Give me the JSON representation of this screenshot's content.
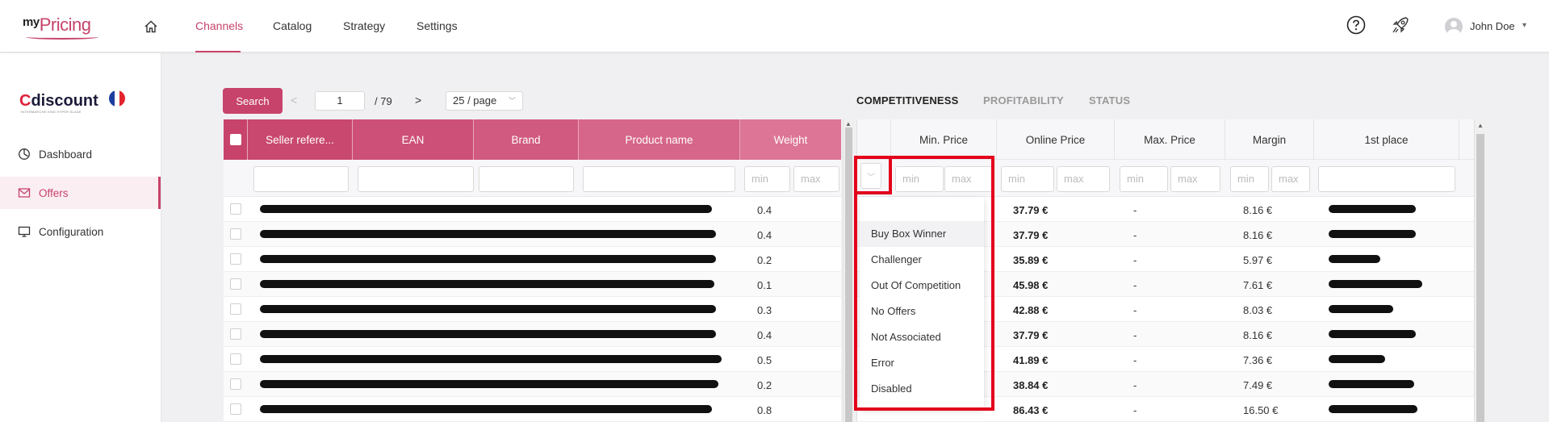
{
  "app": {
    "logo_my": "my",
    "logo_pricing": "Pricing"
  },
  "nav": {
    "items": [
      "Channels",
      "Catalog",
      "Strategy",
      "Settings"
    ],
    "active": "Channels"
  },
  "user": {
    "name": "John Doe"
  },
  "sidebar": {
    "channel_logo_c": "C",
    "channel_logo_rest": "discount",
    "channel_tagline": "INTERMARCHE EIND HYPER SLADE",
    "items": [
      {
        "label": "Dashboard",
        "icon": "dashboard-icon"
      },
      {
        "label": "Offers",
        "icon": "mail-icon",
        "active": true
      },
      {
        "label": "Configuration",
        "icon": "monitor-icon"
      }
    ]
  },
  "toolbar": {
    "search_label": "Search",
    "prev": "<",
    "page": "1",
    "total": "/  79",
    "next": ">",
    "page_size": "25 / page"
  },
  "tabs": [
    "COMPETITIVENESS",
    "PROFITABILITY",
    "STATUS"
  ],
  "left_table": {
    "columns": [
      "Seller refere...",
      "EAN",
      "Brand",
      "Product name",
      "Weight"
    ],
    "filter_min": "min",
    "filter_max": "max",
    "weights": [
      "0.4",
      "0.4",
      "0.2",
      "0.1",
      "0.3",
      "0.4",
      "0.5",
      "0.2",
      "0.8"
    ]
  },
  "right_table": {
    "columns": [
      "Min. Price",
      "Online Price",
      "Max. Price",
      "Margin",
      "1st place"
    ],
    "filter_min": "min",
    "filter_max": "max",
    "rows": [
      {
        "online": "37.79 €",
        "max": "-",
        "margin": "8.16 €"
      },
      {
        "online": "37.79 €",
        "max": "-",
        "margin": "8.16 €"
      },
      {
        "online": "35.89 €",
        "max": "-",
        "margin": "5.97 €"
      },
      {
        "online": "45.98 €",
        "max": "-",
        "margin": "7.61 €"
      },
      {
        "online": "42.88 €",
        "max": "-",
        "margin": "8.03 €"
      },
      {
        "online": "37.79 €",
        "max": "-",
        "margin": "8.16 €"
      },
      {
        "online": "41.89 €",
        "max": "-",
        "margin": "7.36 €"
      },
      {
        "online": "38.84 €",
        "max": "-",
        "margin": "7.49 €"
      },
      {
        "online": "86.43 €",
        "max": "-",
        "margin": "16.50 €"
      }
    ]
  },
  "status_dropdown": {
    "options": [
      "Buy Box Winner",
      "Challenger",
      "Out Of Competition",
      "No Offers",
      "Not Associated",
      "Error",
      "Disabled"
    ],
    "hovered": "Buy Box Winner"
  },
  "colors": {
    "accent": "#c7436b",
    "highlight": "#e3001b"
  }
}
